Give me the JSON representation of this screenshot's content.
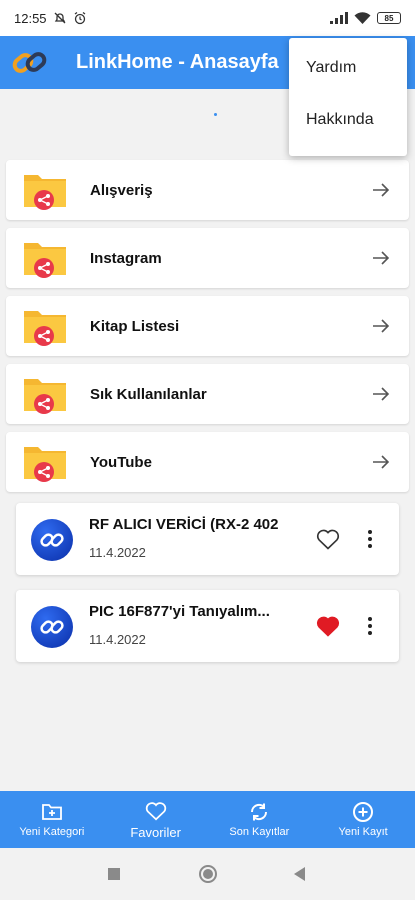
{
  "status_bar": {
    "time": "12:55",
    "battery": "85"
  },
  "app_bar": {
    "title": "LinkHome - Anasayfa",
    "logo_icon": "chain-link-logo-icon"
  },
  "menu": {
    "items": [
      {
        "label": "Yardım"
      },
      {
        "label": "Hakkında"
      }
    ]
  },
  "categories": [
    {
      "label": "Alışveriş"
    },
    {
      "label": "Instagram"
    },
    {
      "label": "Kitap Listesi"
    },
    {
      "label": "Sık Kullanılanlar"
    },
    {
      "label": "YouTube"
    }
  ],
  "links": [
    {
      "title": "RF ALICI VERİCİ (RX-2 402",
      "date": "11.4.2022",
      "favorite": false
    },
    {
      "title": "PIC 16F877'yi Tanıyalım...",
      "date": "11.4.2022",
      "favorite": true
    }
  ],
  "bottom_nav": {
    "items": [
      {
        "label": "Yeni Kategori",
        "icon": "folder-plus-icon"
      },
      {
        "label": "Favoriler",
        "icon": "heart-outline-icon"
      },
      {
        "label": "Son Kayıtlar",
        "icon": "sync-icon"
      },
      {
        "label": "Yeni Kayıt",
        "icon": "plus-circle-icon"
      }
    ]
  },
  "colors": {
    "primary": "#3a8ff0",
    "folder": "#fbc841",
    "share_badge": "#e8394a",
    "favorite": "#e01b24"
  }
}
